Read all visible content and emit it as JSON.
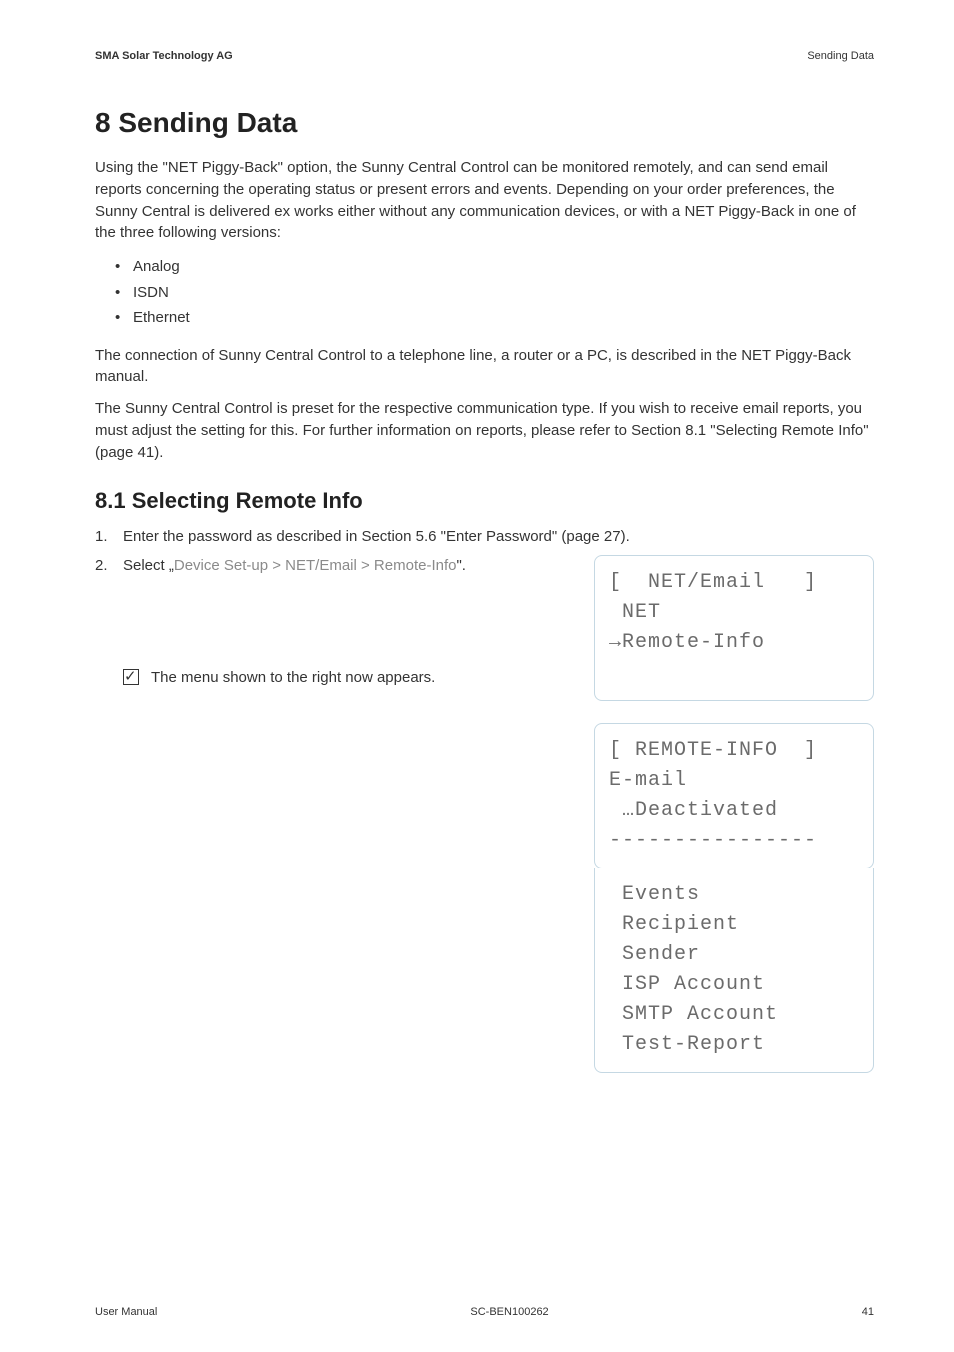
{
  "header": {
    "left": "SMA Solar Technology AG",
    "right": "Sending Data"
  },
  "chapter": {
    "title": "8 Sending Data",
    "para1": "Using the \"NET Piggy-Back\" option, the Sunny Central Control can be monitored remotely, and can send email reports concerning the operating status or present errors and events. Depending on your order preferences, the Sunny Central is delivered ex works either without any communication devices, or with a NET Piggy-Back in one of the three following versions:",
    "bullets": [
      "Analog",
      "ISDN",
      "Ethernet"
    ],
    "para2": "The connection of Sunny Central Control to a telephone line, a router or a PC, is described in the NET Piggy-Back manual.",
    "para3": "The Sunny Central Control is preset for the respective communication type. If you wish to receive email reports, you must adjust the setting for this. For further information on reports, please refer to Section 8.1 \"Selecting Remote Info\" (page 41)."
  },
  "section81": {
    "title": "8.1 Selecting Remote Info",
    "step1": "Enter the password as described in Section 5.6 \"Enter Password\" (page 27).",
    "step2_prefix": "Select „",
    "step2_path": "Device Set-up > NET/Email > Remote-Info",
    "step2_suffix": "\".",
    "check_text": "The menu shown to the right now appears."
  },
  "screen1": {
    "l1": "[  NET/Email   ]",
    "l2": " NET",
    "l3": "→Remote-Info"
  },
  "screen2a": {
    "l1": "[ REMOTE-INFO  ]",
    "l2": "E-mail",
    "l3": " …Deactivated",
    "l4": "----------------"
  },
  "screen2b": {
    "l1": " Events",
    "l2": " Recipient",
    "l3": " Sender",
    "l4": " ISP Account",
    "l5": " SMTP Account",
    "l6": " Test-Report"
  },
  "footer": {
    "left": "User Manual",
    "center": "SC-BEN100262",
    "right": "41"
  }
}
